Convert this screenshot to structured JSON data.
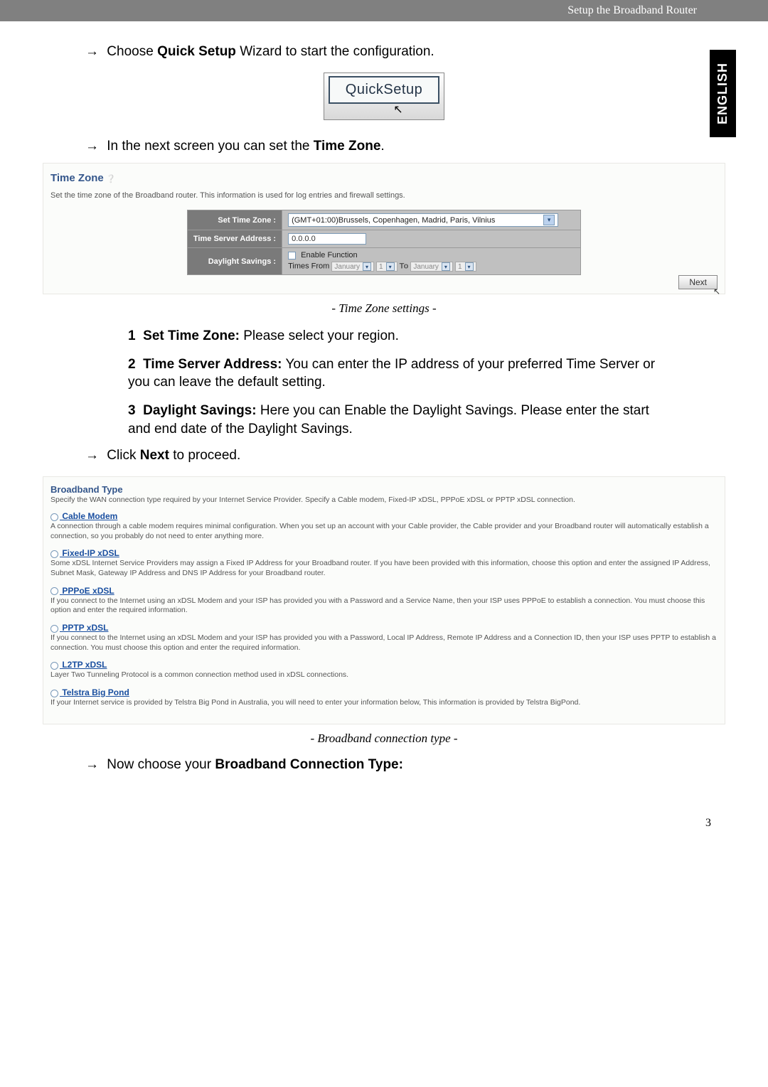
{
  "header": {
    "breadcrumb": "Setup the Broadband Router"
  },
  "side_tab": "ENGLISH",
  "arrow_lines": {
    "a": {
      "pre": "Choose ",
      "bold": "Quick Setup",
      "post": " Wizard to start the configuration."
    },
    "b": {
      "pre": "In the next screen you can set the ",
      "bold": "Time Zone",
      "post": "."
    },
    "c": {
      "pre": "Click ",
      "bold": "Next",
      "post": " to proceed."
    },
    "d": {
      "pre": "Now choose your ",
      "bold": "Broadband Connection Type:",
      "post": ""
    }
  },
  "quick_setup_button": "QuickSetup",
  "tz_panel": {
    "title": "Time Zone",
    "desc": "Set the time zone of the Broadband router. This information is used for log entries and firewall settings.",
    "rows": {
      "set_tz_label": "Set Time Zone :",
      "set_tz_value": "(GMT+01:00)Brussels, Copenhagen, Madrid, Paris, Vilnius",
      "tsa_label": "Time Server Address :",
      "tsa_value": "0.0.0.0",
      "ds_label": "Daylight Savings :",
      "ds_enable": "Enable Function",
      "ds_times_from": "Times From",
      "ds_from_month": "January",
      "ds_from_day": "1",
      "ds_to": "To",
      "ds_to_month": "January",
      "ds_to_day": "1"
    },
    "next_button": "Next"
  },
  "captions": {
    "tz": "- Time Zone settings -",
    "bb": "- Broadband connection type -"
  },
  "numbered": [
    {
      "n": "1",
      "bold": "Set Time Zone:",
      "text": " Please select your region."
    },
    {
      "n": "2",
      "bold": "Time Server Address:",
      "text": " You can enter the IP address of your preferred Time Server or you can leave the default setting."
    },
    {
      "n": "3",
      "bold": "Daylight Savings:",
      "text": " Here you can Enable the Daylight Savings. Please enter the start and end date of the Daylight Savings."
    }
  ],
  "bb_panel": {
    "head": "Broadband Type",
    "sub": "Specify the WAN connection type required by your Internet Service Provider. Specify a Cable modem, Fixed-IP xDSL, PPPoE xDSL or PPTP xDSL connection.",
    "items": [
      {
        "link": " Cable Modem",
        "desc": "A connection through a cable modem requires minimal configuration. When you set up an account with your Cable provider, the Cable provider and your Broadband router will automatically establish a connection, so you probably do not need to enter anything more."
      },
      {
        "link": " Fixed-IP xDSL",
        "desc": "Some xDSL Internet Service Providers may assign a Fixed IP Address for your Broadband router. If you have been provided with this information, choose this option and enter the assigned IP Address, Subnet Mask, Gateway IP Address and DNS IP Address for your Broadband router."
      },
      {
        "link": " PPPoE xDSL",
        "desc": "If you connect to the Internet using an xDSL Modem and your ISP has provided you with a Password and a Service Name, then your ISP uses PPPoE to establish a connection. You must choose this option and enter the required information."
      },
      {
        "link": " PPTP xDSL",
        "desc": "If you connect to the Internet using an xDSL Modem and your ISP has provided you with a Password, Local IP Address, Remote IP Address and a Connection ID, then your ISP uses PPTP to establish a connection. You must choose this option and enter the required information."
      },
      {
        "link": " L2TP xDSL",
        "desc": "Layer Two Tunneling Protocol is a common connection method used in xDSL connections."
      },
      {
        "link": " Telstra Big Pond",
        "desc": "If your Internet service is provided by Telstra Big Pond in Australia, you will need to enter your information below, This information is provided by Telstra BigPond."
      }
    ]
  },
  "page_number": "3"
}
